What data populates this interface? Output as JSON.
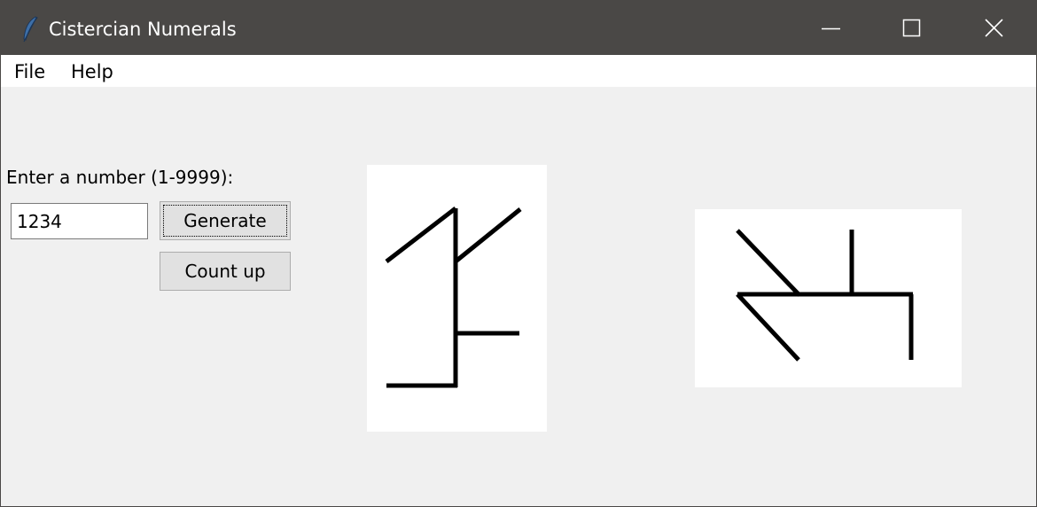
{
  "window": {
    "title": "Cistercian Numerals",
    "icon": "feather-icon",
    "controls": {
      "minimize_icon": "minimize-icon",
      "maximize_icon": "maximize-icon",
      "close_icon": "close-icon"
    }
  },
  "menubar": {
    "items": [
      {
        "label": "File"
      },
      {
        "label": "Help"
      }
    ]
  },
  "form": {
    "prompt": "Enter a number (1-9999):",
    "input_value": "1234",
    "generate_label": "Generate",
    "count_up_label": "Count up"
  },
  "glyphs": {
    "vertical_numeral": {
      "value": 1234,
      "orientation": "vertical"
    },
    "horizontal_numeral": {
      "value": 1234,
      "orientation": "horizontal"
    }
  },
  "colors": {
    "titlebar": "#4a4846",
    "window_background": "#f0f0f0",
    "canvas_background": "#ffffff",
    "stroke": "#000000",
    "button_face": "#e1e1e1"
  }
}
